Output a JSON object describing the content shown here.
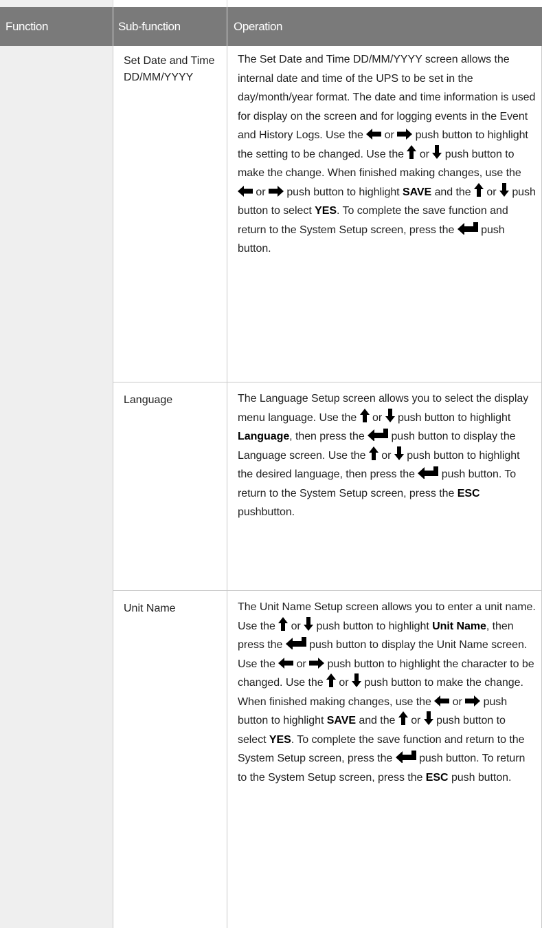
{
  "header": {
    "function": "Function",
    "sub_function": "Sub-function",
    "operation": "Operation"
  },
  "rows": [
    {
      "sub_function": "Set Date and Time DD/MM/YYYY",
      "operation": [
        {
          "t": "The Set Date and Time DD/MM/YYYY screen allows the internal date and time of the UPS to be set in the day/month/year format. The date and time information is used for display on the screen and for logging events in the Event and History Logs. Use the "
        },
        {
          "i": "left-arrow-icon"
        },
        {
          "t": " or "
        },
        {
          "i": "right-arrow-icon"
        },
        {
          "t": " push button to highlight the setting to be changed. Use the "
        },
        {
          "i": "up-arrow-icon"
        },
        {
          "t": " or "
        },
        {
          "i": "down-arrow-icon"
        },
        {
          "t": " push button to make the change. When finished making changes, use the "
        },
        {
          "i": "left-arrow-icon"
        },
        {
          "t": " or "
        },
        {
          "i": "right-arrow-icon"
        },
        {
          "t": " push button to highlight "
        },
        {
          "b": "SAVE"
        },
        {
          "t": " and the "
        },
        {
          "i": "up-arrow-icon"
        },
        {
          "t": " or "
        },
        {
          "i": "down-arrow-icon"
        },
        {
          "t": " push button to select "
        },
        {
          "b": "YES"
        },
        {
          "t": ". To complete the save function and return to the System Setup screen, press the "
        },
        {
          "i": "enter-arrow-icon"
        },
        {
          "t": " push button."
        }
      ]
    },
    {
      "sub_function": "Language",
      "operation": [
        {
          "t": "The Language Setup screen allows you to select the display menu language. Use the "
        },
        {
          "i": "up-arrow-icon"
        },
        {
          "t": " or "
        },
        {
          "i": "down-arrow-icon"
        },
        {
          "t": " push button to highlight "
        },
        {
          "b": "Language"
        },
        {
          "t": ", then press the "
        },
        {
          "i": "enter-arrow-icon"
        },
        {
          "t": " push button to display the Language screen. Use the "
        },
        {
          "i": "up-arrow-icon"
        },
        {
          "t": " or "
        },
        {
          "i": "down-arrow-icon"
        },
        {
          "t": " push button to highlight the desired language, then press the "
        },
        {
          "i": "enter-arrow-icon"
        },
        {
          "t": " push button. To return to the System Setup screen, press the "
        },
        {
          "b": "ESC"
        },
        {
          "t": " pushbutton."
        }
      ]
    },
    {
      "sub_function": "Unit Name",
      "operation": [
        {
          "t": "The Unit Name Setup screen allows you to enter a unit name. Use the "
        },
        {
          "i": "up-arrow-icon"
        },
        {
          "t": " or "
        },
        {
          "i": "down-arrow-icon"
        },
        {
          "t": " push button to highlight "
        },
        {
          "b": "Unit Name"
        },
        {
          "t": ", then press the "
        },
        {
          "i": "enter-arrow-icon"
        },
        {
          "t": " push button to display the Unit Name screen. Use the "
        },
        {
          "i": "left-arrow-icon"
        },
        {
          "t": " or "
        },
        {
          "i": "right-arrow-icon"
        },
        {
          "t": " push button to highlight the character to be changed. Use the "
        },
        {
          "i": "up-arrow-icon"
        },
        {
          "t": " or "
        },
        {
          "i": "down-arrow-icon"
        },
        {
          "t": " push button to make the change. When finished making changes, use the "
        },
        {
          "i": "left-arrow-icon"
        },
        {
          "t": " or "
        },
        {
          "i": "right-arrow-icon"
        },
        {
          "t": " push button to highlight "
        },
        {
          "b": "SAVE"
        },
        {
          "t": " and the "
        },
        {
          "i": "up-arrow-icon"
        },
        {
          "t": " or "
        },
        {
          "i": "down-arrow-icon"
        },
        {
          "t": " push button to select "
        },
        {
          "b": "YES"
        },
        {
          "t": ". To complete the save function and return to the System Setup screen, press the "
        },
        {
          "i": "enter-arrow-icon"
        },
        {
          "t": " push button. To return to the System Setup screen, press the "
        },
        {
          "b": "ESC"
        },
        {
          "t": " push button."
        }
      ]
    }
  ]
}
